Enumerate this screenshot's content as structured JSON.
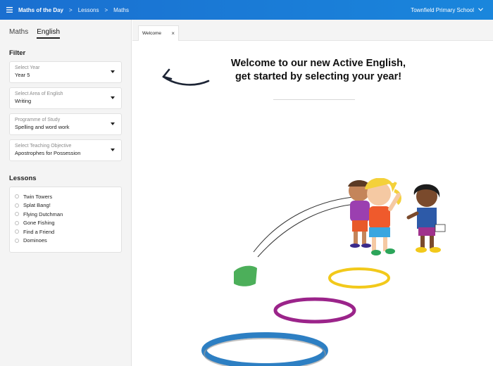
{
  "header": {
    "app_name": "Maths of the Day",
    "breadcrumb": [
      "Lessons",
      "Maths"
    ],
    "separator": ">",
    "school": "Townfield Primary School",
    "menu_icon": "hamburger-icon",
    "background": "#1a7ad6"
  },
  "sidebar": {
    "subjects": [
      {
        "label": "Maths",
        "active": false
      },
      {
        "label": "English",
        "active": true
      }
    ],
    "filter_title": "Filter",
    "filters": [
      {
        "placeholder": "Select Year",
        "value": "Year 5"
      },
      {
        "placeholder": "Select Area of English",
        "value": "Writing"
      },
      {
        "placeholder": "Programme of Study",
        "value": "Spelling and word work"
      },
      {
        "placeholder": "Select Teaching Objective",
        "value": "Apostrophes for Possession"
      }
    ],
    "lessons_title": "Lessons",
    "lessons": [
      "Twin Towers",
      "Splat Bang!",
      "Flying Dutchman",
      "Gone Fishing",
      "Find a Friend",
      "Dominoes"
    ]
  },
  "tabs": [
    {
      "label": "Welcome",
      "close": "×"
    }
  ],
  "main": {
    "welcome_line1": "Welcome to our new Active English,",
    "welcome_line2": "get started by selecting your year!"
  }
}
